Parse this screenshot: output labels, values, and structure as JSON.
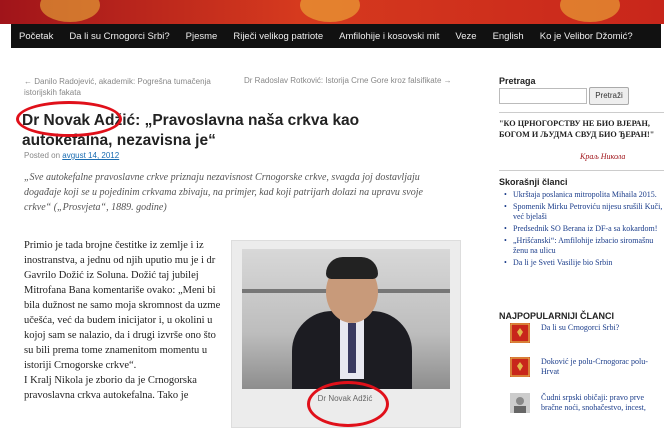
{
  "nav": {
    "items": [
      "Početak",
      "Da li su Crnogorci Srbi?",
      "Pjesme",
      "Riječi velikog patriote",
      "Amfilohije i kosovski mit",
      "Veze",
      "English",
      "Ko je Velibor Džomić?"
    ]
  },
  "post": {
    "prev_link": "← Danilo Radojević, akademik: Pogrešna tumačenja istorijskih fakata",
    "next_link": "Dr Radoslav Rotković: Istorija Crne Gore kroz falsifikate →",
    "title": "Dr Novak Adžić: „Pravoslavna naša crkva kao autokefalna, nezavisna je“",
    "posted_on": "Posted on",
    "date": "avgust 14, 2012",
    "quote": "„Sve autokefalne pravoslavne crkve priznaju nezavisnost Crnogorske crkve, svagda joj dostavljaju događaje koji se u pojedinim crkvama zbivaju, na primjer, kad koji patrijarh dolazi na upravu svoje crkve“ („Prosvjeta“, 1889. godine)",
    "body": "Primio je tada brojne čestitke iz zemlje i iz inostranstva, a jednu od njih uputio mu je i dr Gavrilo Dožić iz Soluna. Dožić taj jubilej Mitrofana Bana komentariše ovako: „Meni bi bila dužnost ne samo moja skromnost da uzme učešća, već da budem inicijator i, u okolini u kojoj sam se nalazio, da i drugi izvrše ono što su bili prema tome znamenitom momentu u istoriji Crnogorske crkve“.\nI Kralj Nikola je zborio da je Crnogorska pravoslavna crkva autokefalna. Tako je",
    "photo_caption": "Dr Novak Adžić"
  },
  "sidebar": {
    "search_heading": "Pretraga",
    "search_button": "Pretraži",
    "motto": "\"КО ЦРНОГОРСТВУ НЕ БИО ВЈЕРАН, БОГОМ И ЉУДМА СВУД БИО ЂЕРАН!\"",
    "motto_signature": "Краљ Никола",
    "recent_heading": "Skorašnji članci",
    "recent": [
      "Ukrštaja poslanica mitropolita Mihaila 2015.",
      "Spomenik Mirku Petroviću nijesu srušili Kuči, već bjelaši",
      "Predsednik SO Berana iz DF-a sa kokardom!",
      "„Hrišćanski“: Amfilohije izbacio siromašnu ženu na ulicu",
      "Da li je Sveti Vasilije bio Srbin"
    ],
    "popular_heading": "NAJPOPULARNIJI ČLANCI",
    "popular": [
      "Da li su Crnogorci Srbi?",
      "Doković je polu-Crnogorac polu-Hrvat",
      "Čudni srpski običaji: pravo prve bračne noći, snohačestvo, incest,"
    ]
  },
  "colors": {
    "banner": "#c8261b",
    "nav_bg": "#111111",
    "link": "#1b6db2",
    "highlight_ring": "#e0101a"
  }
}
